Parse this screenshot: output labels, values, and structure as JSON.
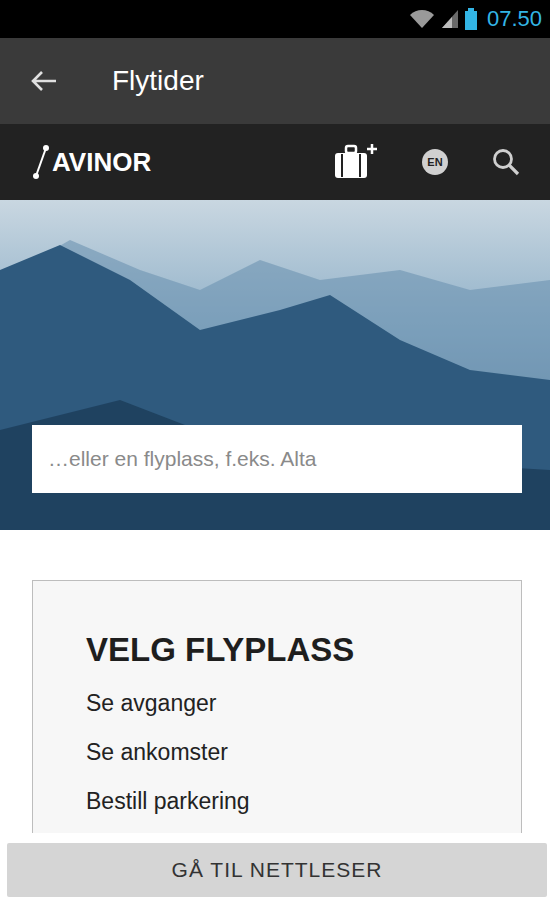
{
  "status_bar": {
    "time": "07.50"
  },
  "app_bar": {
    "title": "Flytider"
  },
  "site_header": {
    "logo": "AVINOR",
    "language": "EN"
  },
  "search": {
    "placeholder": "…eller en flyplass, f.eks. Alta"
  },
  "card": {
    "title": "VELG FLYPLASS",
    "links": [
      "Se avganger",
      "Se ankomster",
      "Bestill parkering"
    ]
  },
  "bottom_button": {
    "label": "GÅ TIL NETTLESER"
  }
}
